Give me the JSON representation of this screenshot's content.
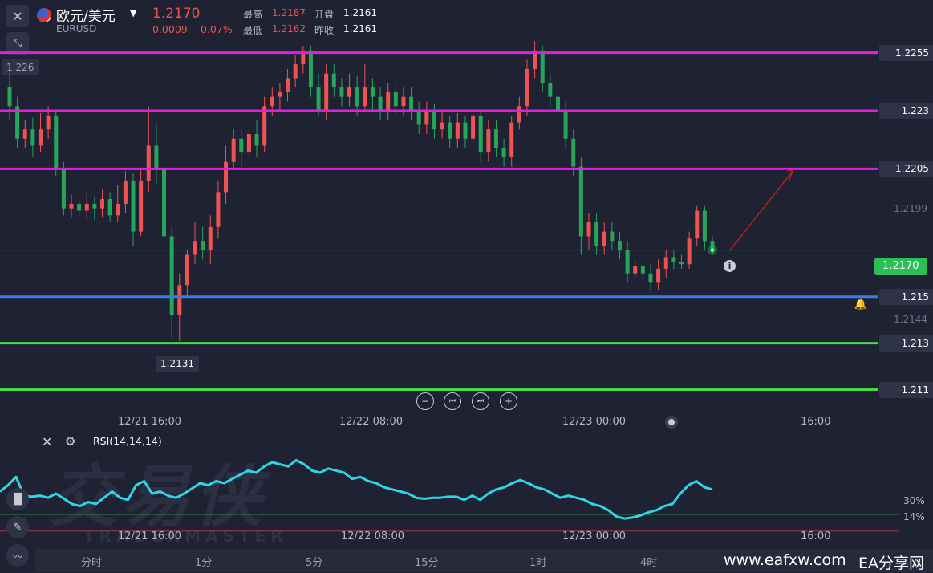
{
  "header": {
    "close_icon": "close-icon",
    "shrink_icon": "shrink-icon",
    "flag_icon": "us-eu-flag-icon",
    "title": "欧元/美元",
    "symbol": "EURUSD",
    "price": "1.2170",
    "change": "0.0009",
    "change_pct": "0.07%",
    "high_label": "最高",
    "high_value": "1.2187",
    "open_label": "开盘",
    "open_value": "1.2161",
    "low_label": "最低",
    "low_value": "1.2162",
    "prev_label": "昨收",
    "prev_value": "1.2161"
  },
  "chart": {
    "top_left_price": "1.226",
    "low_marker": "1.2131",
    "current_price": "1.2170",
    "current_price_color": "#2cbf54",
    "levels": [
      {
        "label": "1.2255",
        "value": 1.2255,
        "color": "#e020e0"
      },
      {
        "label": "1.223",
        "value": 1.223,
        "color": "#e020e0"
      },
      {
        "label": "1.2205",
        "value": 1.2205,
        "color": "#e020e0"
      },
      {
        "label": "1.215",
        "value": 1.215,
        "color": "#3b7de8"
      },
      {
        "label": "1.213",
        "value": 1.213,
        "color": "#44dd44"
      },
      {
        "label": "1.211",
        "value": 1.211,
        "color": "#44dd44"
      }
    ],
    "grey_ticks": [
      "1.2199",
      "1.2144"
    ],
    "time_axis": [
      "12/21 16:00",
      "12/22 08:00",
      "12/23 00:00",
      "16:00"
    ],
    "up_color": "#ef5350",
    "down_color": "#26a65b"
  },
  "controls": {
    "zoom_out": "−",
    "prev": "⏮",
    "next": "⏭",
    "zoom_in": "+"
  },
  "rsi": {
    "label": "RSI(14,14,14)",
    "level_30": "30%",
    "level_14": "14%",
    "time_axis": [
      "12/21 16:00",
      "12/22 08:00",
      "12/23 00:00",
      "16:00"
    ],
    "color": "#2fd6e6"
  },
  "timeframes": [
    "分时",
    "1分",
    "5分",
    "15分",
    "1时",
    "4时"
  ],
  "watermark": {
    "brand_cn": "交易侠",
    "brand_en": "TRADERMASTER",
    "site": "www.eafxw.com",
    "site_cn": "EA分享网"
  },
  "chart_data": {
    "type": "candlestick",
    "candles": [
      {
        "o": 1.224,
        "c": 1.2232,
        "h": 1.2246,
        "l": 1.2226
      },
      {
        "o": 1.2232,
        "c": 1.2218,
        "h": 1.2236,
        "l": 1.2214
      },
      {
        "o": 1.2218,
        "c": 1.2222,
        "h": 1.2226,
        "l": 1.2214
      },
      {
        "o": 1.2222,
        "c": 1.2215,
        "h": 1.2227,
        "l": 1.221
      },
      {
        "o": 1.2215,
        "c": 1.2222,
        "h": 1.2229,
        "l": 1.2212
      },
      {
        "o": 1.2222,
        "c": 1.2228,
        "h": 1.2232,
        "l": 1.2218
      },
      {
        "o": 1.2228,
        "c": 1.2205,
        "h": 1.223,
        "l": 1.2202
      },
      {
        "o": 1.2205,
        "c": 1.2188,
        "h": 1.2208,
        "l": 1.2185
      },
      {
        "o": 1.2188,
        "c": 1.219,
        "h": 1.2194,
        "l": 1.2184
      },
      {
        "o": 1.219,
        "c": 1.2187,
        "h": 1.2193,
        "l": 1.2184
      },
      {
        "o": 1.2187,
        "c": 1.219,
        "h": 1.2195,
        "l": 1.2183
      },
      {
        "o": 1.219,
        "c": 1.2188,
        "h": 1.2193,
        "l": 1.2183
      },
      {
        "o": 1.2188,
        "c": 1.2192,
        "h": 1.2196,
        "l": 1.2184
      },
      {
        "o": 1.2192,
        "c": 1.2185,
        "h": 1.2195,
        "l": 1.2182
      },
      {
        "o": 1.2185,
        "c": 1.219,
        "h": 1.2198,
        "l": 1.2182
      },
      {
        "o": 1.219,
        "c": 1.22,
        "h": 1.2204,
        "l": 1.2186
      },
      {
        "o": 1.22,
        "c": 1.2178,
        "h": 1.2203,
        "l": 1.2172
      },
      {
        "o": 1.2178,
        "c": 1.22,
        "h": 1.2205,
        "l": 1.2176
      },
      {
        "o": 1.22,
        "c": 1.2215,
        "h": 1.2232,
        "l": 1.2195
      },
      {
        "o": 1.2215,
        "c": 1.2205,
        "h": 1.2224,
        "l": 1.2198
      },
      {
        "o": 1.2205,
        "c": 1.2176,
        "h": 1.2208,
        "l": 1.2172
      },
      {
        "o": 1.2176,
        "c": 1.2142,
        "h": 1.218,
        "l": 1.2132
      },
      {
        "o": 1.2142,
        "c": 1.2155,
        "h": 1.216,
        "l": 1.2131
      },
      {
        "o": 1.2155,
        "c": 1.2168,
        "h": 1.217,
        "l": 1.215
      },
      {
        "o": 1.2168,
        "c": 1.2174,
        "h": 1.2182,
        "l": 1.2164
      },
      {
        "o": 1.2174,
        "c": 1.217,
        "h": 1.218,
        "l": 1.2166
      },
      {
        "o": 1.217,
        "c": 1.218,
        "h": 1.2185,
        "l": 1.2164
      },
      {
        "o": 1.218,
        "c": 1.2195,
        "h": 1.22,
        "l": 1.2175
      },
      {
        "o": 1.2195,
        "c": 1.2208,
        "h": 1.2215,
        "l": 1.219
      },
      {
        "o": 1.2208,
        "c": 1.2218,
        "h": 1.2222,
        "l": 1.2205
      },
      {
        "o": 1.2218,
        "c": 1.2212,
        "h": 1.2222,
        "l": 1.2206
      },
      {
        "o": 1.2212,
        "c": 1.222,
        "h": 1.2224,
        "l": 1.2208
      },
      {
        "o": 1.222,
        "c": 1.2215,
        "h": 1.2226,
        "l": 1.221
      },
      {
        "o": 1.2215,
        "c": 1.2232,
        "h": 1.2236,
        "l": 1.2212
      },
      {
        "o": 1.2232,
        "c": 1.2236,
        "h": 1.224,
        "l": 1.2228
      },
      {
        "o": 1.2236,
        "c": 1.2238,
        "h": 1.2242,
        "l": 1.223
      },
      {
        "o": 1.2238,
        "c": 1.2244,
        "h": 1.2248,
        "l": 1.2234
      },
      {
        "o": 1.2244,
        "c": 1.225,
        "h": 1.2254,
        "l": 1.224
      },
      {
        "o": 1.225,
        "c": 1.2256,
        "h": 1.2258,
        "l": 1.2246
      },
      {
        "o": 1.2256,
        "c": 1.224,
        "h": 1.2258,
        "l": 1.2236
      },
      {
        "o": 1.224,
        "c": 1.223,
        "h": 1.2246,
        "l": 1.2228
      },
      {
        "o": 1.223,
        "c": 1.2246,
        "h": 1.225,
        "l": 1.2226
      },
      {
        "o": 1.2246,
        "c": 1.224,
        "h": 1.225,
        "l": 1.2236
      },
      {
        "o": 1.224,
        "c": 1.2236,
        "h": 1.2244,
        "l": 1.2232
      },
      {
        "o": 1.2236,
        "c": 1.224,
        "h": 1.2246,
        "l": 1.2232
      },
      {
        "o": 1.224,
        "c": 1.2232,
        "h": 1.2245,
        "l": 1.2228
      },
      {
        "o": 1.2232,
        "c": 1.224,
        "h": 1.225,
        "l": 1.223
      },
      {
        "o": 1.224,
        "c": 1.2236,
        "h": 1.2244,
        "l": 1.223
      },
      {
        "o": 1.2236,
        "c": 1.223,
        "h": 1.224,
        "l": 1.2226
      },
      {
        "o": 1.223,
        "c": 1.2238,
        "h": 1.2242,
        "l": 1.2226
      },
      {
        "o": 1.2238,
        "c": 1.2232,
        "h": 1.2242,
        "l": 1.2228
      },
      {
        "o": 1.2232,
        "c": 1.2236,
        "h": 1.224,
        "l": 1.2228
      },
      {
        "o": 1.2236,
        "c": 1.223,
        "h": 1.224,
        "l": 1.2226
      },
      {
        "o": 1.223,
        "c": 1.2224,
        "h": 1.2234,
        "l": 1.222
      },
      {
        "o": 1.2224,
        "c": 1.223,
        "h": 1.2234,
        "l": 1.222
      },
      {
        "o": 1.223,
        "c": 1.2222,
        "h": 1.2233,
        "l": 1.2218
      },
      {
        "o": 1.2222,
        "c": 1.2225,
        "h": 1.223,
        "l": 1.2218
      },
      {
        "o": 1.2225,
        "c": 1.2218,
        "h": 1.2228,
        "l": 1.2214
      },
      {
        "o": 1.2218,
        "c": 1.2225,
        "h": 1.2229,
        "l": 1.2214
      },
      {
        "o": 1.2225,
        "c": 1.2218,
        "h": 1.2228,
        "l": 1.2214
      },
      {
        "o": 1.2218,
        "c": 1.2228,
        "h": 1.2232,
        "l": 1.2214
      },
      {
        "o": 1.2228,
        "c": 1.2212,
        "h": 1.223,
        "l": 1.2208
      },
      {
        "o": 1.2212,
        "c": 1.2222,
        "h": 1.2226,
        "l": 1.2208
      },
      {
        "o": 1.2222,
        "c": 1.2214,
        "h": 1.2226,
        "l": 1.221
      },
      {
        "o": 1.2214,
        "c": 1.221,
        "h": 1.2218,
        "l": 1.2206
      },
      {
        "o": 1.221,
        "c": 1.2225,
        "h": 1.2228,
        "l": 1.2206
      },
      {
        "o": 1.2225,
        "c": 1.2232,
        "h": 1.2236,
        "l": 1.2222
      },
      {
        "o": 1.2232,
        "c": 1.2248,
        "h": 1.2252,
        "l": 1.2228
      },
      {
        "o": 1.2248,
        "c": 1.2256,
        "h": 1.226,
        "l": 1.2244
      },
      {
        "o": 1.2256,
        "c": 1.2242,
        "h": 1.2258,
        "l": 1.2238
      },
      {
        "o": 1.2242,
        "c": 1.2236,
        "h": 1.2246,
        "l": 1.2232
      },
      {
        "o": 1.2236,
        "c": 1.223,
        "h": 1.2244,
        "l": 1.2226
      },
      {
        "o": 1.223,
        "c": 1.2218,
        "h": 1.2234,
        "l": 1.2214
      },
      {
        "o": 1.2218,
        "c": 1.2206,
        "h": 1.2222,
        "l": 1.2202
      },
      {
        "o": 1.2206,
        "c": 1.2176,
        "h": 1.221,
        "l": 1.2168
      },
      {
        "o": 1.2176,
        "c": 1.2182,
        "h": 1.2186,
        "l": 1.217
      },
      {
        "o": 1.2182,
        "c": 1.2172,
        "h": 1.2186,
        "l": 1.2168
      },
      {
        "o": 1.2172,
        "c": 1.2178,
        "h": 1.2182,
        "l": 1.2168
      },
      {
        "o": 1.2178,
        "c": 1.2174,
        "h": 1.2182,
        "l": 1.217
      },
      {
        "o": 1.2174,
        "c": 1.217,
        "h": 1.2178,
        "l": 1.2166
      },
      {
        "o": 1.217,
        "c": 1.216,
        "h": 1.2174,
        "l": 1.2156
      },
      {
        "o": 1.216,
        "c": 1.2163,
        "h": 1.2166,
        "l": 1.2158
      },
      {
        "o": 1.2163,
        "c": 1.216,
        "h": 1.2166,
        "l": 1.2156
      },
      {
        "o": 1.216,
        "c": 1.2156,
        "h": 1.2164,
        "l": 1.2153
      },
      {
        "o": 1.2156,
        "c": 1.2162,
        "h": 1.2166,
        "l": 1.2153
      },
      {
        "o": 1.2162,
        "c": 1.2167,
        "h": 1.217,
        "l": 1.2158
      },
      {
        "o": 1.2167,
        "c": 1.2165,
        "h": 1.217,
        "l": 1.2162
      },
      {
        "o": 1.2165,
        "c": 1.2164,
        "h": 1.2168,
        "l": 1.2162
      },
      {
        "o": 1.2164,
        "c": 1.2175,
        "h": 1.2178,
        "l": 1.2162
      },
      {
        "o": 1.2175,
        "c": 1.2187,
        "h": 1.2189,
        "l": 1.2172
      },
      {
        "o": 1.2187,
        "c": 1.2174,
        "h": 1.2189,
        "l": 1.217
      },
      {
        "o": 1.2174,
        "c": 1.217,
        "h": 1.2176,
        "l": 1.2168
      }
    ],
    "ylim": [
      1.2105,
      1.2268
    ],
    "rsi_values": [
      52,
      58,
      66,
      48,
      47,
      48,
      46,
      50,
      45,
      40,
      38,
      42,
      40,
      46,
      52,
      46,
      44,
      58,
      62,
      50,
      52,
      48,
      46,
      50,
      55,
      60,
      58,
      62,
      60,
      64,
      68,
      72,
      70,
      76,
      80,
      78,
      76,
      82,
      78,
      72,
      70,
      74,
      72,
      70,
      64,
      66,
      62,
      60,
      56,
      54,
      52,
      50,
      46,
      45,
      46,
      46,
      47,
      47,
      44,
      48,
      44,
      50,
      54,
      56,
      60,
      63,
      60,
      56,
      54,
      50,
      46,
      48,
      46,
      44,
      40,
      38,
      34,
      28,
      26,
      27,
      29,
      32,
      34,
      38,
      40,
      50,
      58,
      62,
      56,
      54
    ],
    "rsi_ylim": [
      0,
      100
    ],
    "rsi_levels": [
      30,
      14
    ]
  }
}
